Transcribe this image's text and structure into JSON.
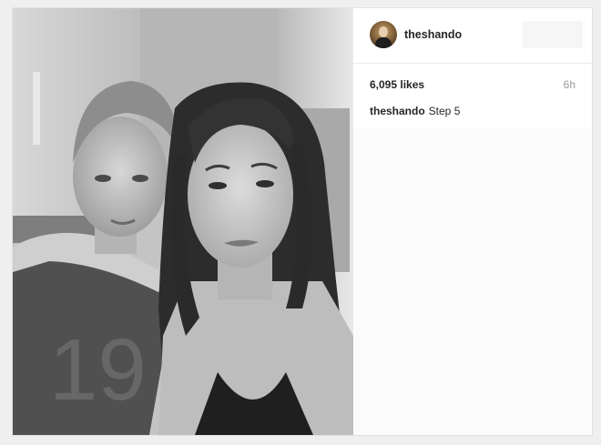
{
  "post": {
    "username": "theshando",
    "likes": "6,095 likes",
    "time": "6h",
    "caption_user": "theshando",
    "caption_text": "Step 5"
  },
  "photo": {
    "jersey_number": "19"
  },
  "icons": {
    "avatar": "profile-avatar"
  }
}
